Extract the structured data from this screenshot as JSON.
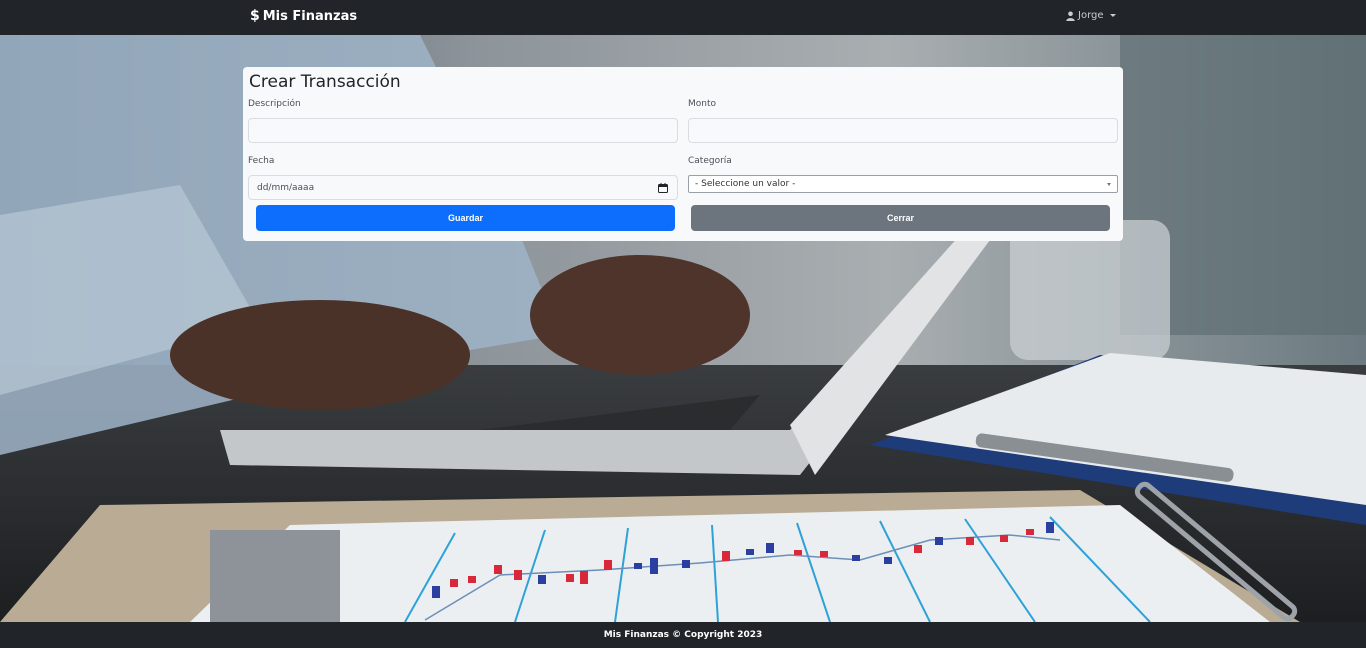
{
  "navbar": {
    "brand_icon": "dollar-icon",
    "brand": "Mis Finanzas",
    "user_icon": "person-icon",
    "user": "Jorge"
  },
  "form": {
    "title": "Crear Transacción",
    "descripcion_label": "Descripción",
    "descripcion_value": "",
    "monto_label": "Monto",
    "monto_value": "",
    "fecha_label": "Fecha",
    "fecha_placeholder": "dd/mm/aaaa",
    "categoria_label": "Categoría",
    "categoria_selected": "- Seleccione un valor -",
    "save_label": "Guardar",
    "close_label": "Cerrar"
  },
  "footer": {
    "text": "Mis Finanzas © Copyright 2023"
  },
  "colors": {
    "navbar": "#212529",
    "primary": "#0d6efd",
    "secondary": "#6c757d",
    "card": "#f8f9fa"
  }
}
